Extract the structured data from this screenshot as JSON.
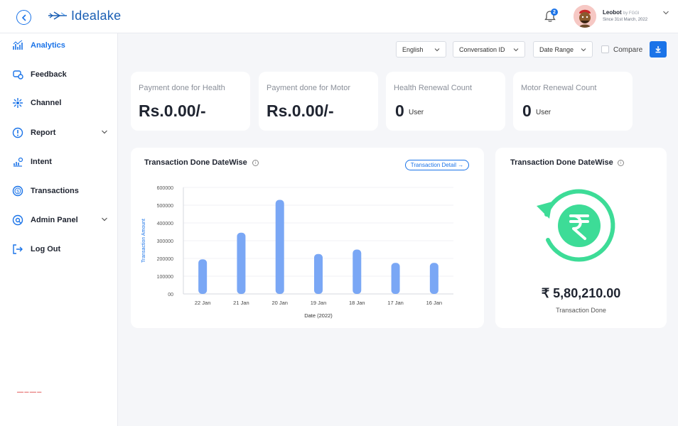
{
  "header": {
    "app_name": "Idealake",
    "notification_count": "2",
    "user_name": "Leobot",
    "user_by": "by FGGI",
    "user_since": "Since 31st March, 2022"
  },
  "sidebar": {
    "items": [
      {
        "label": "Analytics"
      },
      {
        "label": "Feedback"
      },
      {
        "label": "Channel"
      },
      {
        "label": "Report"
      },
      {
        "label": "Intent"
      },
      {
        "label": "Transactions"
      },
      {
        "label": "Admin Panel"
      },
      {
        "label": "Log Out"
      }
    ]
  },
  "filters": {
    "language": "English",
    "conversation": "Conversation ID",
    "date_range": "Date Range",
    "compare_label": "Compare"
  },
  "stats": [
    {
      "title": "Payment done for Health",
      "value": "Rs.0.00/-"
    },
    {
      "title": "Payment done for Motor",
      "value": "Rs.0.00/-"
    },
    {
      "title": "Health Renewal Count",
      "value": "0",
      "unit": "User"
    },
    {
      "title": "Motor Renewal Count",
      "value": "0",
      "unit": "User"
    }
  ],
  "bar_card": {
    "title": "Transaction Done DateWise",
    "detail_button": "Transaction Detail →"
  },
  "summary_card": {
    "title": "Transaction Done DateWise",
    "amount": "₹ 5,80,210.00",
    "amount_label": "Transaction Done"
  },
  "colors": {
    "accent": "#1a73e8",
    "bar": "#7aa7f5",
    "green": "#3ddc97"
  },
  "chart_data": {
    "type": "bar",
    "categories": [
      "22 Jan",
      "21 Jan",
      "20 Jan",
      "19 Jan",
      "18 Jan",
      "17 Jan",
      "16 Jan"
    ],
    "values": [
      195000,
      345000,
      530000,
      225000,
      250000,
      175000,
      175000
    ],
    "ylim": [
      0,
      600000
    ],
    "yticks": [
      "600000",
      "500000",
      "400000",
      "300000",
      "200000",
      "100000",
      "00"
    ],
    "xlabel": "Date (2022)",
    "ylabel": "Transaction Amount",
    "grid": true
  }
}
